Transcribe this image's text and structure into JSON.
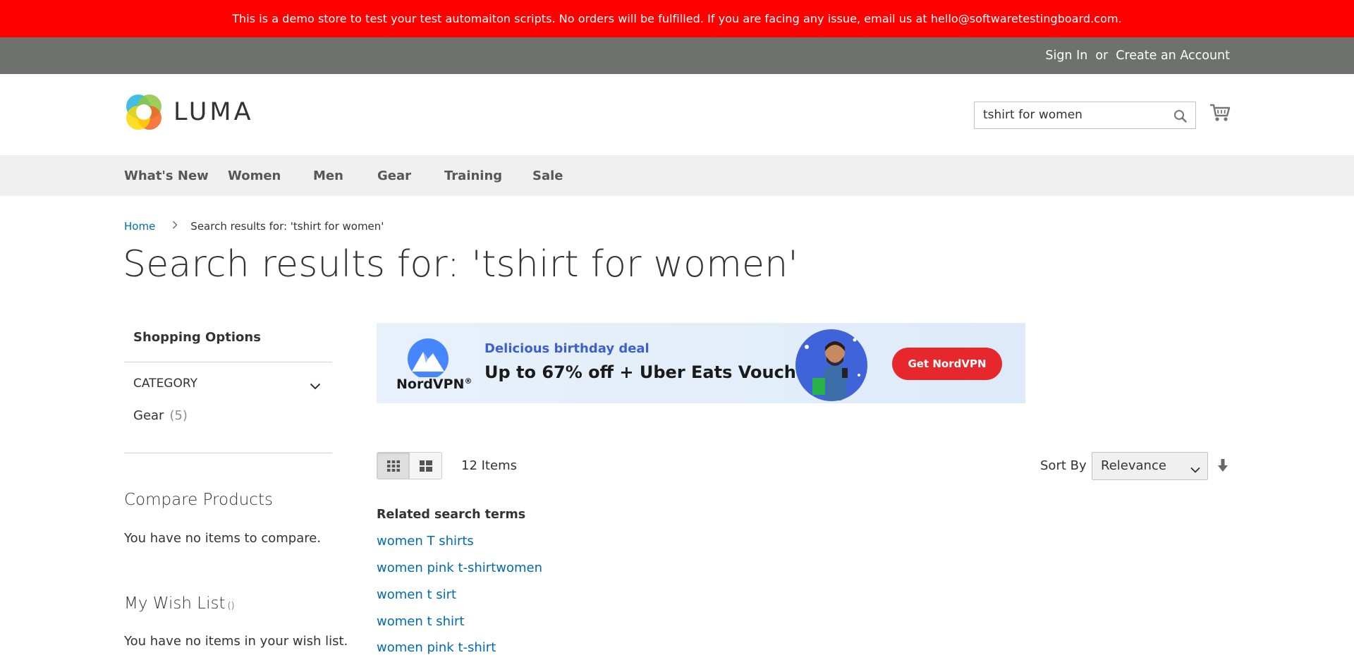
{
  "demo_notice": "This is a demo store to test your test automaiton scripts. No orders will be fulfilled. If you are facing any issue, email us at hello@softwaretestingboard.com.",
  "header": {
    "sign_in": "Sign In",
    "or": "or",
    "create_account": "Create an Account",
    "logo_text": "LUMA",
    "search_value": "tshirt for women",
    "search_icon": "search-icon",
    "cart_icon": "cart-icon"
  },
  "nav": {
    "items": [
      "What's New",
      "Women",
      "Men",
      "Gear",
      "Training",
      "Sale"
    ]
  },
  "breadcrumb": {
    "home": "Home",
    "current": "Search results for: 'tshirt for women'"
  },
  "page_title": "Search results for: 'tshirt for women'",
  "sidebar": {
    "shopping_options": "Shopping Options",
    "category_label": "Category",
    "category_items": [
      {
        "label": "Gear",
        "count": "(5)"
      }
    ],
    "compare_title": "Compare Products",
    "compare_empty": "You have no items to compare.",
    "wishlist_title": "My Wish List",
    "wishlist_counter": "()",
    "wishlist_empty": "You have no items in your wish list."
  },
  "ad": {
    "brand": "NordVPN",
    "subtitle": "Delicious birthday deal",
    "title": "Up to 67% off + Uber Eats Voucher",
    "button": "Get NordVPN",
    "colors": {
      "button": "#e6282c",
      "brand_blue": "#4687ff",
      "subtitle": "#3e5fd0"
    }
  },
  "toolbar": {
    "items_count": "12 Items",
    "sort_label": "Sort By",
    "sort_value": "Relevance",
    "view_modes": [
      "grid",
      "list"
    ],
    "active_mode": "grid"
  },
  "related": {
    "title": "Related search terms",
    "terms": [
      "women T shirts",
      "women pink t-shirtwomen",
      "women t sirt",
      "women t shirt",
      "women pink t-shirt"
    ]
  },
  "colors": {
    "demo_bar": "#ff0000",
    "panel_header": "#6e716e",
    "nav_bg": "#f0f0f0",
    "link": "#006bb4"
  }
}
